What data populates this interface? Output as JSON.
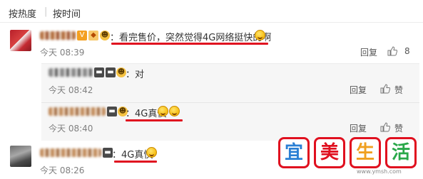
{
  "sort": {
    "hot": "按热度",
    "separator": "|",
    "time": "按时间"
  },
  "comments": [
    {
      "text": "：看完售价，突然觉得4G网络挺快的啊",
      "time": "今天 08:39",
      "reply_label": "回复",
      "likes": "8"
    },
    {
      "text": "：对",
      "time": "今天 08:42",
      "reply_label": "回复",
      "like_label": "赞"
    },
    {
      "text": "：4G真快",
      "time": "今天 08:40",
      "reply_label": "回复",
      "like_label": "赞"
    },
    {
      "text": "：4G真快",
      "time": "今天 08:26"
    }
  ],
  "watermark": {
    "chars": [
      "宜",
      "美",
      "生",
      "活"
    ],
    "url": "www.ymsh.com"
  },
  "colors": {
    "underline": "#e0101f",
    "reply_bg": "#f6f6f6",
    "watermark_border": "#e0101f"
  }
}
